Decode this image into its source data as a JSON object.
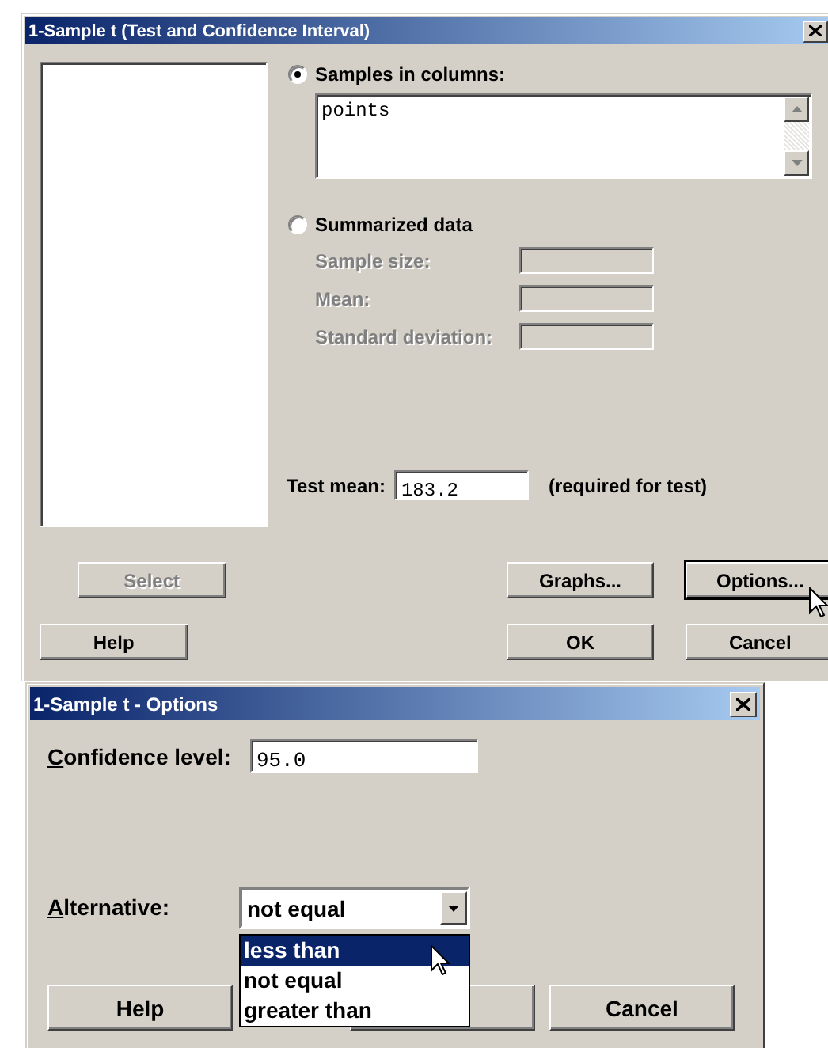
{
  "main_dialog": {
    "title": "1-Sample t (Test and Confidence Interval)",
    "input_modes": [
      {
        "kind": "columns",
        "label": "Samples in columns:",
        "selected": true,
        "value": "points"
      },
      {
        "kind": "summary",
        "label": "Summarized data",
        "selected": false,
        "fields": [
          {
            "label": "Sample size:",
            "disabled": true
          },
          {
            "label": "Mean:",
            "disabled": true
          },
          {
            "label": "Standard deviation:",
            "disabled": true
          }
        ]
      }
    ],
    "test_mean": {
      "label": "Test mean:",
      "value": "183.2",
      "note": "(required for test)"
    },
    "button_rows": [
      {
        "buttons": [
          {
            "label": "Select",
            "disabled": true,
            "focused": false
          },
          {
            "label": "Graphs...",
            "disabled": false,
            "focused": false
          },
          {
            "label": "Options...",
            "disabled": false,
            "focused": true
          }
        ]
      },
      {
        "buttons": [
          {
            "label": "Help",
            "disabled": false,
            "focused": false
          },
          {
            "label": "OK",
            "disabled": false,
            "focused": false
          },
          {
            "label": "Cancel",
            "disabled": false,
            "focused": false
          }
        ]
      }
    ]
  },
  "options_dialog": {
    "title": "1-Sample t - Options",
    "confidence": {
      "label": "Confidence level:",
      "value": "95.0"
    },
    "alternative": {
      "label": "Alternative:",
      "value": "not equal",
      "expanded": true,
      "options": [
        {
          "label": "less than",
          "highlighted": true
        },
        {
          "label": "not equal",
          "highlighted": false
        },
        {
          "label": "greater than",
          "highlighted": false
        }
      ]
    },
    "buttons": [
      {
        "label": "Help"
      },
      {
        "label": "Cancel"
      }
    ]
  }
}
